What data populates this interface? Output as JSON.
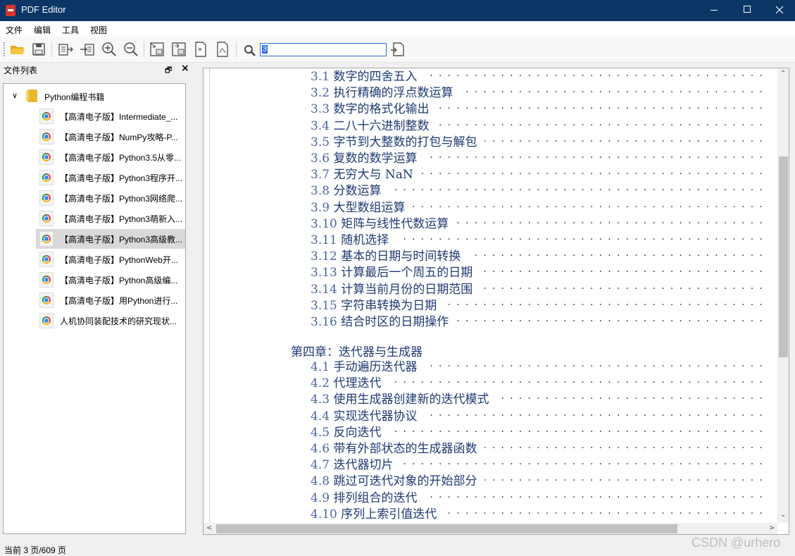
{
  "window": {
    "title": "PDF Editor",
    "icon": "pdf-app-icon"
  },
  "menu": [
    "文件",
    "编辑",
    "工具",
    "视图"
  ],
  "toolbar": {
    "buttons": [
      "open-folder-icon",
      "save-icon",
      "export-text-icon",
      "import-text-icon",
      "zoom-in-icon",
      "zoom-out-icon",
      "extract-image-icon",
      "replace-image-icon",
      "split-pdf-icon",
      "pdf-convert-icon",
      "search-icon",
      "go-to-page-icon"
    ],
    "page_input_value": "3"
  },
  "sidebar": {
    "title": "文件列表",
    "root": "Python编程书籍",
    "files": [
      "【高清电子版】Intermediate_...",
      "【高清电子版】NumPy攻略-P...",
      "【高清电子版】Python3.5从零...",
      "【高清电子版】Python3程序开...",
      "【高清电子版】Python3网络爬...",
      "【高清电子版】Python3萌新入...",
      "【高清电子版】Python3高级教...",
      "【高清电子版】PythonWeb开...",
      "【高清电子版】Python高级编...",
      "【高清电子版】用Python进行...",
      "人机协同装配技术的研究现状..."
    ],
    "selected_index": 6
  },
  "document": {
    "toc_top": [
      {
        "num": "3.1",
        "title": "数字的四舍五入"
      },
      {
        "num": "3.2",
        "title": "执行精确的浮点数运算"
      },
      {
        "num": "3.3",
        "title": "数字的格式化输出"
      },
      {
        "num": "3.4",
        "title": "二八十六进制整数"
      },
      {
        "num": "3.5",
        "title": "字节到大整数的打包与解包"
      },
      {
        "num": "3.6",
        "title": "复数的数学运算"
      },
      {
        "num": "3.7",
        "title": "无穷大与 NaN"
      },
      {
        "num": "3.8",
        "title": "分数运算"
      },
      {
        "num": "3.9",
        "title": "大型数组运算"
      },
      {
        "num": "3.10",
        "title": "矩阵与线性代数运算"
      },
      {
        "num": "3.11",
        "title": "随机选择"
      },
      {
        "num": "3.12",
        "title": "基本的日期与时间转换"
      },
      {
        "num": "3.13",
        "title": "计算最后一个周五的日期"
      },
      {
        "num": "3.14",
        "title": "计算当前月份的日期范围"
      },
      {
        "num": "3.15",
        "title": "字符串转换为日期"
      },
      {
        "num": "3.16",
        "title": "结合时区的日期操作"
      }
    ],
    "chapter": "第四章：迭代器与生成器",
    "toc_bottom": [
      {
        "num": "4.1",
        "title": "手动遍历迭代器"
      },
      {
        "num": "4.2",
        "title": "代理迭代"
      },
      {
        "num": "4.3",
        "title": "使用生成器创建新的迭代模式"
      },
      {
        "num": "4.4",
        "title": "实现迭代器协议"
      },
      {
        "num": "4.5",
        "title": "反向迭代"
      },
      {
        "num": "4.6",
        "title": "带有外部状态的生成器函数"
      },
      {
        "num": "4.7",
        "title": "迭代器切片"
      },
      {
        "num": "4.8",
        "title": "跳过可迭代对象的开始部分"
      },
      {
        "num": "4.9",
        "title": "排列组合的迭代"
      },
      {
        "num": "4.10",
        "title": "序列上索引值迭代"
      }
    ]
  },
  "status": "当前 3 页/609 页",
  "watermark": "CSDN @urhero"
}
